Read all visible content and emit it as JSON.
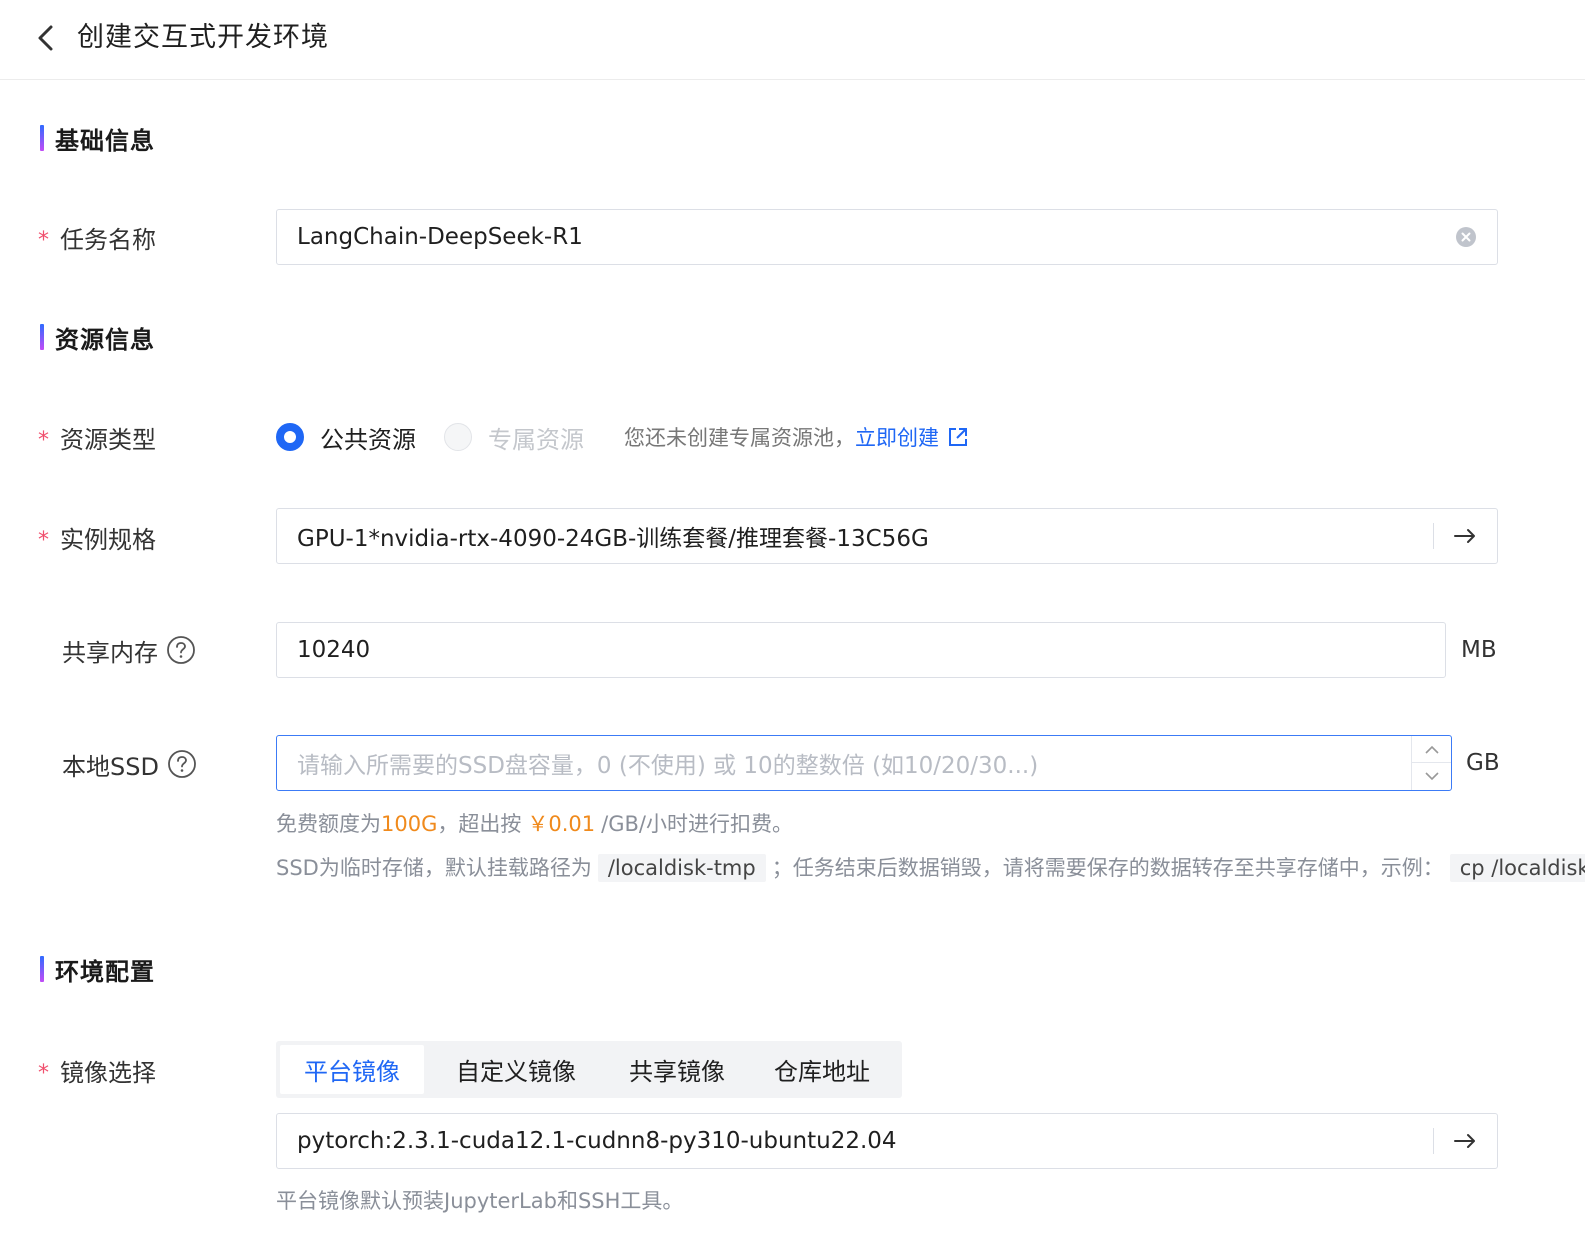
{
  "header": {
    "title": "创建交互式开发环境"
  },
  "sections": {
    "basic": "基础信息",
    "resource": "资源信息",
    "env": "环境配置"
  },
  "task_name": {
    "label": "任务名称",
    "value": "LangChain-DeepSeek-R1"
  },
  "resource_type": {
    "label": "资源类型",
    "options": [
      {
        "label": "公共资源",
        "selected": true,
        "disabled": false
      },
      {
        "label": "专属资源",
        "selected": false,
        "disabled": true
      }
    ],
    "hint": "您还未创建专属资源池，",
    "link": "立即创建"
  },
  "instance_spec": {
    "label": "实例规格",
    "value": "GPU-1*nvidia-rtx-4090-24GB-训练套餐/推理套餐-13C56G"
  },
  "shared_memory": {
    "label": "共享内存",
    "value": "10240",
    "unit": "MB"
  },
  "local_ssd": {
    "label": "本地SSD",
    "placeholder": "请输入所需要的SSD盘容量，0 (不使用) 或 10的整数倍 (如10/20/30...)",
    "unit": "GB",
    "hint1": {
      "prefix": "免费额度为",
      "free": "100G",
      "middle": "，超出按",
      "price": "￥0.01",
      "suffix": "/GB/小时进行扣费。"
    },
    "hint2": {
      "prefix": "SSD为临时存储，默认挂载路径为",
      "path": "/localdisk-tmp",
      "middle": "；任务结束后数据销毁，请将需要保存的数据转存至共享存储中，示例：",
      "example": "cp /localdisk-tmp"
    }
  },
  "image_select": {
    "label": "镜像选择",
    "tabs": [
      "平台镜像",
      "自定义镜像",
      "共享镜像",
      "仓库地址"
    ],
    "active_tab": 0,
    "value": "pytorch:2.3.1-cuda12.1-cudnn8-py310-ubuntu22.04",
    "hint": "平台镜像默认预装JupyterLab和SSH工具。"
  },
  "colors": {
    "primary": "#1f67f5",
    "required": "#f0506e",
    "highlight": "#f08a1c"
  }
}
